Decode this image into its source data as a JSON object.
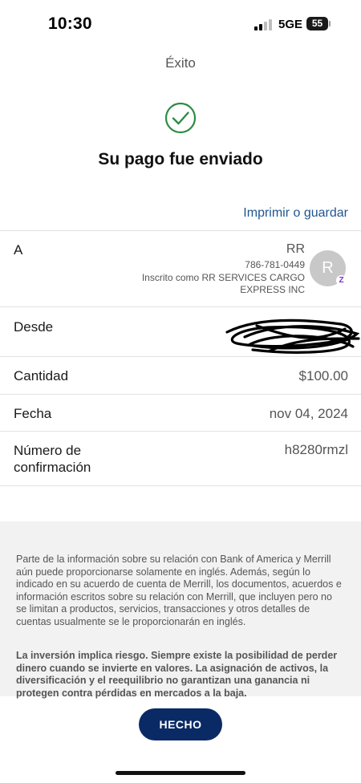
{
  "status_bar": {
    "time": "10:30",
    "network": "5GE",
    "battery": "55"
  },
  "header": {
    "title": "Éxito"
  },
  "success": {
    "icon": "check-circle-icon",
    "icon_color": "#2e8b45",
    "headline": "Su pago fue enviado"
  },
  "actions": {
    "print_label": "Imprimir o guardar",
    "link_color": "#1f5590"
  },
  "details": {
    "to": {
      "label": "A",
      "name": "RR",
      "phone": "786-781-0449",
      "enrolled": "Inscrito como RR SERVICES CARGO EXPRESS INC",
      "avatar_initial": "R",
      "badge": "Z"
    },
    "from": {
      "label": "Desde"
    },
    "amount": {
      "label": "Cantidad",
      "value": "$100.00"
    },
    "date": {
      "label": "Fecha",
      "value": "nov 04, 2024"
    },
    "confirmation": {
      "label": "Número de confirmación",
      "value": "h8280rmzl"
    }
  },
  "disclosure": {
    "paragraph1": "Parte de la información sobre su relación con Bank of America y Merrill aún puede proporcionarse solamente en inglés. Además, según lo indicado en su acuerdo de cuenta de Merrill, los documentos, acuerdos e información escritos sobre su relación con Merrill, que incluyen pero no se limitan a productos, servicios, transacciones y otros detalles de cuentas usualmente se le proporcionarán en inglés.",
    "paragraph2": "La inversión implica riesgo. Siempre existe la posibilidad de perder dinero cuando se invierte en valores. La asignación de activos, la diversificación y el reequilibrio no garantizan una ganancia ni protegen contra pérdidas en mercados a la baja."
  },
  "footer": {
    "done_label": "HECHO",
    "button_color": "#0a2a66"
  }
}
